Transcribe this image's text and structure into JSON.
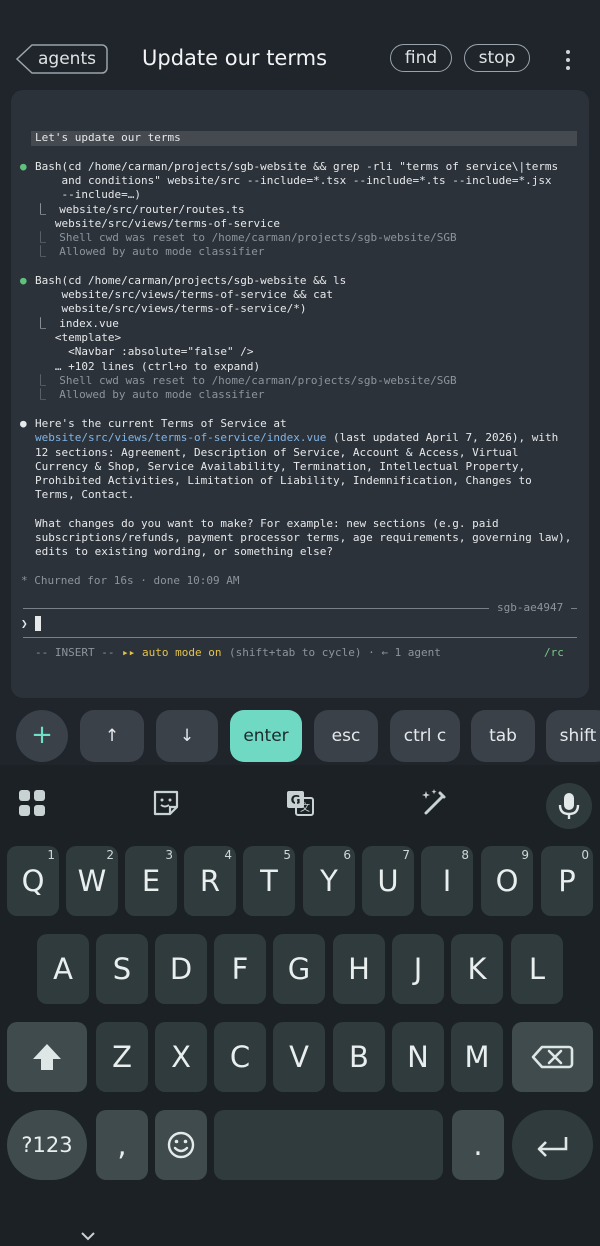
{
  "header": {
    "back_label": "agents",
    "title": "Update our terms",
    "find_label": "find",
    "stop_label": "stop"
  },
  "terminal": {
    "user_prompt": "Let's update our terms",
    "bash1": {
      "bullet": "●",
      "line1": "Bash(cd /home/carman/projects/sgb-website && grep -rli \"terms of service\\|terms",
      "line2": "    and conditions\" website/src --include=*.tsx --include=*.ts --include=*.jsx",
      "line3": "    --include=…)",
      "out1": "⎿  website/src/router/routes.ts",
      "out2": "   website/src/views/terms-of-service",
      "note1": "⎿  Shell cwd was reset to /home/carman/projects/sgb-website/SGB",
      "note2": "⎿  Allowed by auto mode classifier"
    },
    "bash2": {
      "bullet": "●",
      "line1": "Bash(cd /home/carman/projects/sgb-website && ls",
      "line2": "    website/src/views/terms-of-service && cat",
      "line3": "    website/src/views/terms-of-service/*)",
      "out1": "⎿  index.vue",
      "out2": "   <template>",
      "out3": "     <Navbar :absolute=\"false\" />",
      "out4": "   … +102 lines (ctrl+o to expand)",
      "note1": "⎿  Shell cwd was reset to /home/carman/projects/sgb-website/SGB",
      "note2": "⎿  Allowed by auto mode classifier"
    },
    "reply": {
      "bullet": "●",
      "line1": "Here's the current Terms of Service at",
      "link": "website/src/views/terms-of-service/index.vue",
      "line2_rest": " (last updated April 7, 2026), with",
      "line3": "12 sections: Agreement, Description of Service, Account & Access, Virtual",
      "line4": "Currency & Shop, Service Availability, Termination, Intellectual Property,",
      "line5": "Prohibited Activities, Limitation of Liability, Indemnification, Changes to",
      "line6": "Terms, Contact.",
      "line7": "What changes do you want to make? For example: new sections (e.g. paid",
      "line8": "subscriptions/refunds, payment processor terms, age requirements, governing law),",
      "line9": "edits to existing wording, or something else?"
    },
    "churned": "* Churned for 16s · done 10:09 AM",
    "session_id": "sgb-ae4947",
    "prompt_symbol": "❯",
    "status": {
      "mode": "-- INSERT --",
      "auto_arrows": "▸▸",
      "auto_label": "auto mode on",
      "hint": "(shift+tab to cycle) · ← 1 agent",
      "rc": "/rc"
    }
  },
  "extra_keys": {
    "plus": "+",
    "up": "↑",
    "down": "↓",
    "enter": "enter",
    "esc": "esc",
    "ctrlc": "ctrl c",
    "tab": "tab",
    "shift": "shift"
  },
  "keyboard": {
    "row1": [
      {
        "k": "Q",
        "n": "1"
      },
      {
        "k": "W",
        "n": "2"
      },
      {
        "k": "E",
        "n": "3"
      },
      {
        "k": "R",
        "n": "4"
      },
      {
        "k": "T",
        "n": "5"
      },
      {
        "k": "Y",
        "n": "6"
      },
      {
        "k": "U",
        "n": "7"
      },
      {
        "k": "I",
        "n": "8"
      },
      {
        "k": "O",
        "n": "9"
      },
      {
        "k": "P",
        "n": "0"
      }
    ],
    "row2": [
      "A",
      "S",
      "D",
      "F",
      "G",
      "H",
      "J",
      "K",
      "L"
    ],
    "row3": [
      "Z",
      "X",
      "C",
      "V",
      "B",
      "N",
      "M"
    ],
    "symbols": "?123",
    "comma": ",",
    "period": "."
  },
  "colors": {
    "accent": "#6fd9c4",
    "terminal_bg": "#2c323a",
    "link": "#7fb4e6",
    "success_dot": "#5ec27a",
    "auto_mode": "#e4c24a"
  }
}
